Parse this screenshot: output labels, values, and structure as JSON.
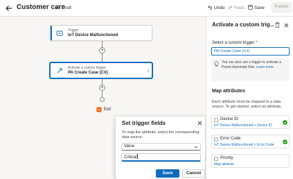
{
  "header": {
    "title": "Customer care",
    "status": "Draft",
    "undo_label": "Undo",
    "redo_label": "Redo",
    "save_label": "Save",
    "publish_label": "Publish"
  },
  "flow": {
    "trigger_card": {
      "subtitle": "Trigger",
      "title": "IoT Device Malfunctioned"
    },
    "action_card": {
      "subtitle": "Activate a custom trigger",
      "title": "PA Create Case (CX)"
    },
    "exit_label": "Exit"
  },
  "dialog": {
    "title": "Set trigger fields",
    "description": "To map the attribute, select the corresponding data source.",
    "select_value": "Value",
    "input_value": "Critical",
    "save_label": "Save",
    "cancel_label": "Cancel"
  },
  "panel": {
    "title": "Activate a custom trig...",
    "field_label": "Select a custom trigger",
    "field_value": "PA Create Case (CX)",
    "info_text": "You can also use a trigger to activate a Power Automate flow.",
    "info_link": "Learn more",
    "section_title": "Map attributes",
    "section_desc": "Each attribute must be mapped to a data source. To get started, select an attribute.",
    "attributes": [
      {
        "name": "Device ID",
        "path": "IoT Device Malfunctioned > Device ID",
        "mapped": true
      },
      {
        "name": "Error Code",
        "path": "IoT Device Malfunctioned > Error Code",
        "mapped": true
      },
      {
        "name": "Priority",
        "path": "Map attribute",
        "mapped": false
      }
    ]
  },
  "colors": {
    "accent": "#0f6cbd",
    "success": "#13a10e"
  }
}
